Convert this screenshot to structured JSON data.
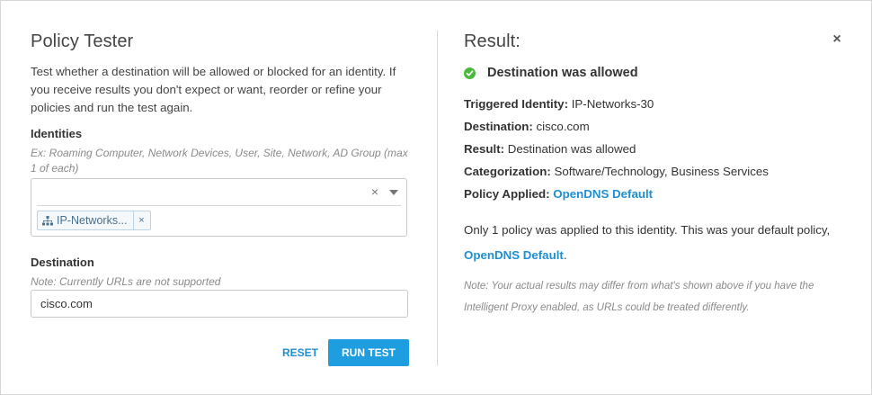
{
  "tester": {
    "title": "Policy Tester",
    "description": "Test whether a destination will be allowed or blocked for an identity. If you receive results you don't expect or want, reorder or refine your policies and run the test again.",
    "identities_label": "Identities",
    "identities_hint": "Ex: Roaming Computer, Network Devices, User, Site, Network, AD Group (max 1 of each)",
    "identities_input_value": "",
    "clear_glyph": "×",
    "selected_identity": "IP-Networks...",
    "chip_remove_glyph": "×",
    "destination_label": "Destination",
    "destination_hint": "Note: Currently URLs are not supported",
    "destination_value": "cisco.com",
    "reset_label": "RESET",
    "run_label": "RUN TEST"
  },
  "result": {
    "title": "Result:",
    "close_glyph": "×",
    "status": "Destination was allowed",
    "rows": [
      {
        "label": "Triggered Identity:",
        "value": "IP-Networks-30"
      },
      {
        "label": "Destination:",
        "value": "cisco.com"
      },
      {
        "label": "Result:",
        "value": "Destination was allowed"
      },
      {
        "label": "Categorization:",
        "value": "Software/Technology, Business Services"
      },
      {
        "label": "Policy Applied:",
        "value": "OpenDNS Default"
      }
    ],
    "summary_text": "Only 1 policy was applied to this identity. This was your default policy,",
    "summary_link": "OpenDNS Default",
    "summary_end": ".",
    "note": "Note: Your actual results may differ from what's shown above if you have the Intelligent Proxy enabled, as URLs could be treated differently."
  },
  "icons": {
    "close": "close-icon",
    "success": "check-circle-icon",
    "identity": "network-hierarchy-icon",
    "dropdown": "chevron-down-icon"
  },
  "colors": {
    "accent": "#1e9ee0",
    "link": "#1e8fd3",
    "success": "#4cb83e",
    "chip_bg": "#f4f8fb"
  }
}
